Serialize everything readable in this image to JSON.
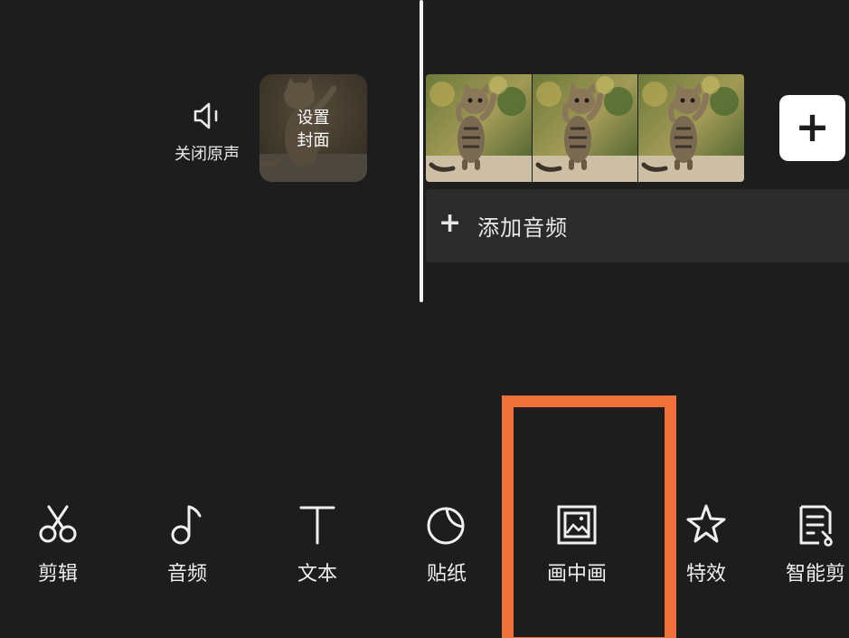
{
  "colors": {
    "background": "#1d1d1d",
    "audio_track_bg": "#2b2b2b",
    "highlight": "#f0703a",
    "text": "#f0f0f0"
  },
  "timeline": {
    "mute_toggle": {
      "label": "关闭原声",
      "icon": "speaker-icon"
    },
    "cover": {
      "line1": "设置",
      "line2": "封面"
    },
    "add_clip": {
      "icon": "plus-icon",
      "glyph": "+"
    },
    "audio_track": {
      "plus": "+",
      "label": "添加音频"
    }
  },
  "toolbar": {
    "items": [
      {
        "label": "剪辑",
        "icon": "scissors-icon"
      },
      {
        "label": "音频",
        "icon": "music-note-icon"
      },
      {
        "label": "文本",
        "icon": "text-icon"
      },
      {
        "label": "贴纸",
        "icon": "sticker-icon"
      },
      {
        "label": "画中画",
        "icon": "picture-in-picture-icon",
        "highlighted": true
      },
      {
        "label": "特效",
        "icon": "star-effect-icon"
      },
      {
        "label": "智能剪",
        "icon": "smart-edit-icon"
      }
    ]
  }
}
